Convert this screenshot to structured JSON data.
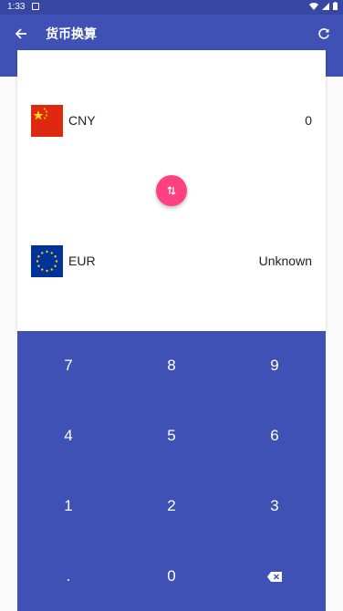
{
  "status_bar": {
    "time": "1:33",
    "icons": [
      "notification-icon",
      "wifi-icon",
      "cellular-icon",
      "battery-icon"
    ]
  },
  "app_bar": {
    "title": "货币换算",
    "back_icon": "arrow-back-icon",
    "refresh_icon": "refresh-icon"
  },
  "converter": {
    "from": {
      "code": "CNY",
      "amount": "0",
      "flag": "china-flag"
    },
    "to": {
      "code": "EUR",
      "amount": "Unknown",
      "flag": "eu-flag"
    },
    "swap_icon": "swap-vertical-icon"
  },
  "keypad": {
    "keys": [
      "7",
      "8",
      "9",
      "4",
      "5",
      "6",
      "1",
      "2",
      "3",
      ".",
      "0"
    ],
    "backspace_icon": "backspace-icon"
  },
  "colors": {
    "primary": "#3f51b5",
    "primary_dark": "#3747a3",
    "accent": "#ff4081"
  }
}
